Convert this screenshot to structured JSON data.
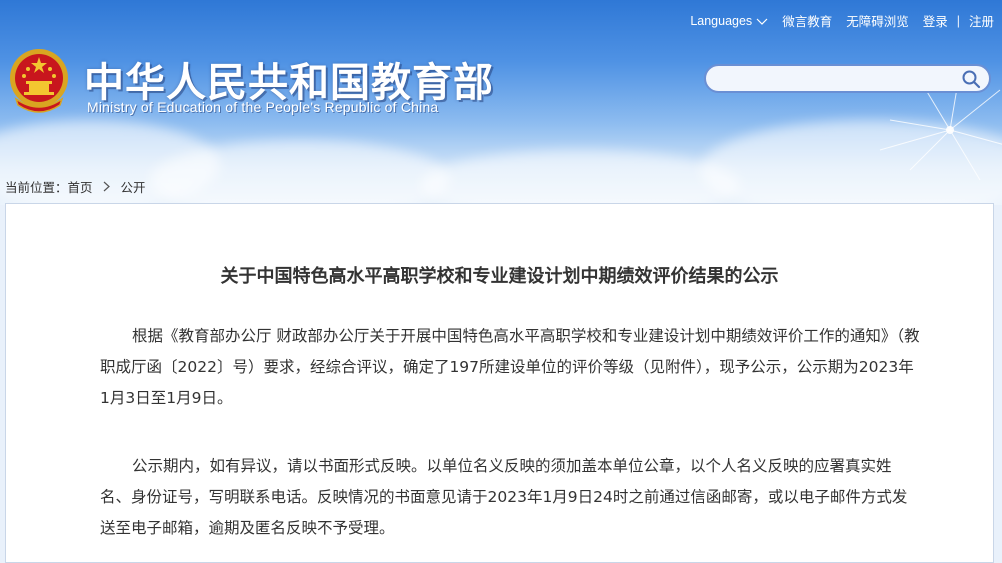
{
  "header": {
    "title_cn": "中华人民共和国教育部",
    "title_en": "Ministry of Education of the People's Republic of China"
  },
  "topnav": {
    "languages": "Languages",
    "weibo": "微言教育",
    "accessibility": "无障碍浏览",
    "login": "登录",
    "separator": "|",
    "register": "注册"
  },
  "search": {
    "placeholder": "",
    "value": ""
  },
  "breadcrumb": {
    "prefix": "当前位置：",
    "home": "首页",
    "current": "公开"
  },
  "article": {
    "title": "关于中国特色高水平高职学校和专业建设计划中期绩效评价结果的公示",
    "paragraphs": [
      "根据《教育部办公厅 财政部办公厅关于开展中国特色高水平高职学校和专业建设计划中期绩效评价工作的通知》（教职成厅函〔2022〕号）要求，经综合评议，确定了197所建设单位的评价等级（见附件），现予公示，公示期为2023年1月3日至1月9日。",
      "公示期内，如有异议，请以书面形式反映。以单位名义反映的须加盖本单位公章，以个人名义反映的应署真实姓名、身份证号，写明联系电话。反映情况的书面意见请于2023年1月9日24时之前通过信函邮寄，或以电子邮件方式发送至电子邮箱，逾期及匿名反映不予受理。"
    ]
  },
  "icons": [
    "national-emblem-icon",
    "chevron-down-icon",
    "search-icon",
    "chevron-right-icon"
  ],
  "colors": {
    "header_top": "#2f78d6",
    "header_bottom": "#eaf3fc",
    "search_border": "#6a8fd4",
    "text": "#333333"
  }
}
